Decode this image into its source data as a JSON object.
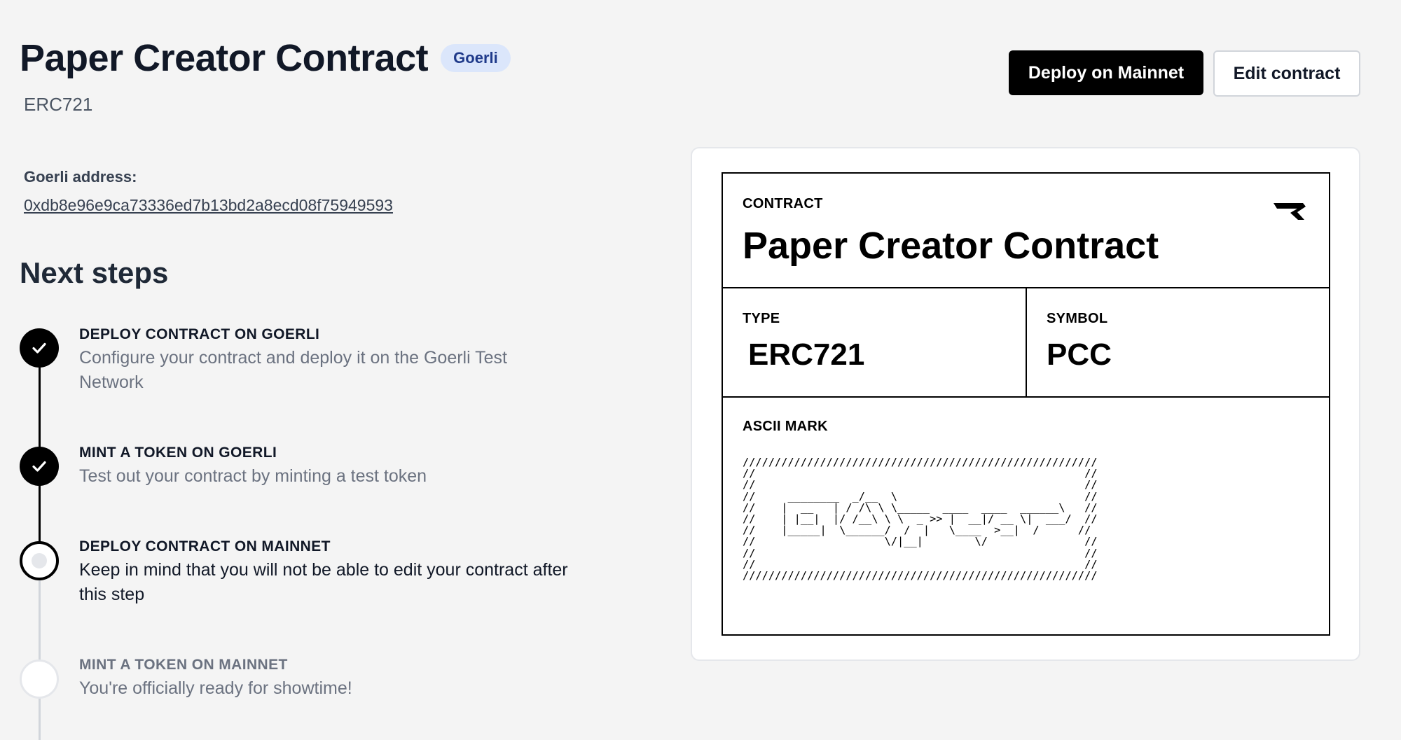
{
  "header": {
    "title": "Paper Creator Contract",
    "network_badge": "Goerli",
    "subtitle": "ERC721",
    "deploy_button": "Deploy on Mainnet",
    "edit_button": "Edit contract"
  },
  "address": {
    "label": "Goerli address:",
    "value": "0xdb8e96e9ca73336ed7b13bd2a8ecd08f75949593"
  },
  "next_steps": {
    "heading": "Next steps",
    "steps": [
      {
        "title": "DEPLOY CONTRACT ON GOERLI",
        "description": "Configure your contract and deploy it on the Goerli Test Network",
        "status": "done"
      },
      {
        "title": "MINT A TOKEN ON GOERLI",
        "description": "Test out your contract by minting a test token",
        "status": "done"
      },
      {
        "title": "DEPLOY CONTRACT ON MAINNET",
        "description": "Keep in mind that you will not be able to edit your contract after this step",
        "status": "current"
      },
      {
        "title": "MINT A TOKEN ON MAINNET",
        "description": "You're officially ready for showtime!",
        "status": "todo"
      }
    ]
  },
  "contract_card": {
    "contract_label": "CONTRACT",
    "contract_name": "Paper Creator Contract",
    "type_label": "TYPE",
    "type_value": "ERC721",
    "symbol_label": "SYMBOL",
    "symbol_value": "PCC",
    "ascii_label": "ASCII MARK",
    "ascii_mark": "///////////////////////////////////////////////////////\n//                                                   //\n//                                                   //\n//     ________  _/__  \\                             //\n//    |  __   | / /\\ \\ \\_____  ____  ____  ______\\   //\n//    | |__|  |/ /__\\ \\ \\  _ >> |  __|/ __ \\|  ___/  //\n//    |_____|  \\______/  /  |   \\____  >__|  /      //\n//                    \\/|__|        \\/               //\n//                                                   //\n//                                                   //\n///////////////////////////////////////////////////////"
  },
  "icons": {
    "check": "check-icon",
    "logo": "paper-logo-icon"
  }
}
